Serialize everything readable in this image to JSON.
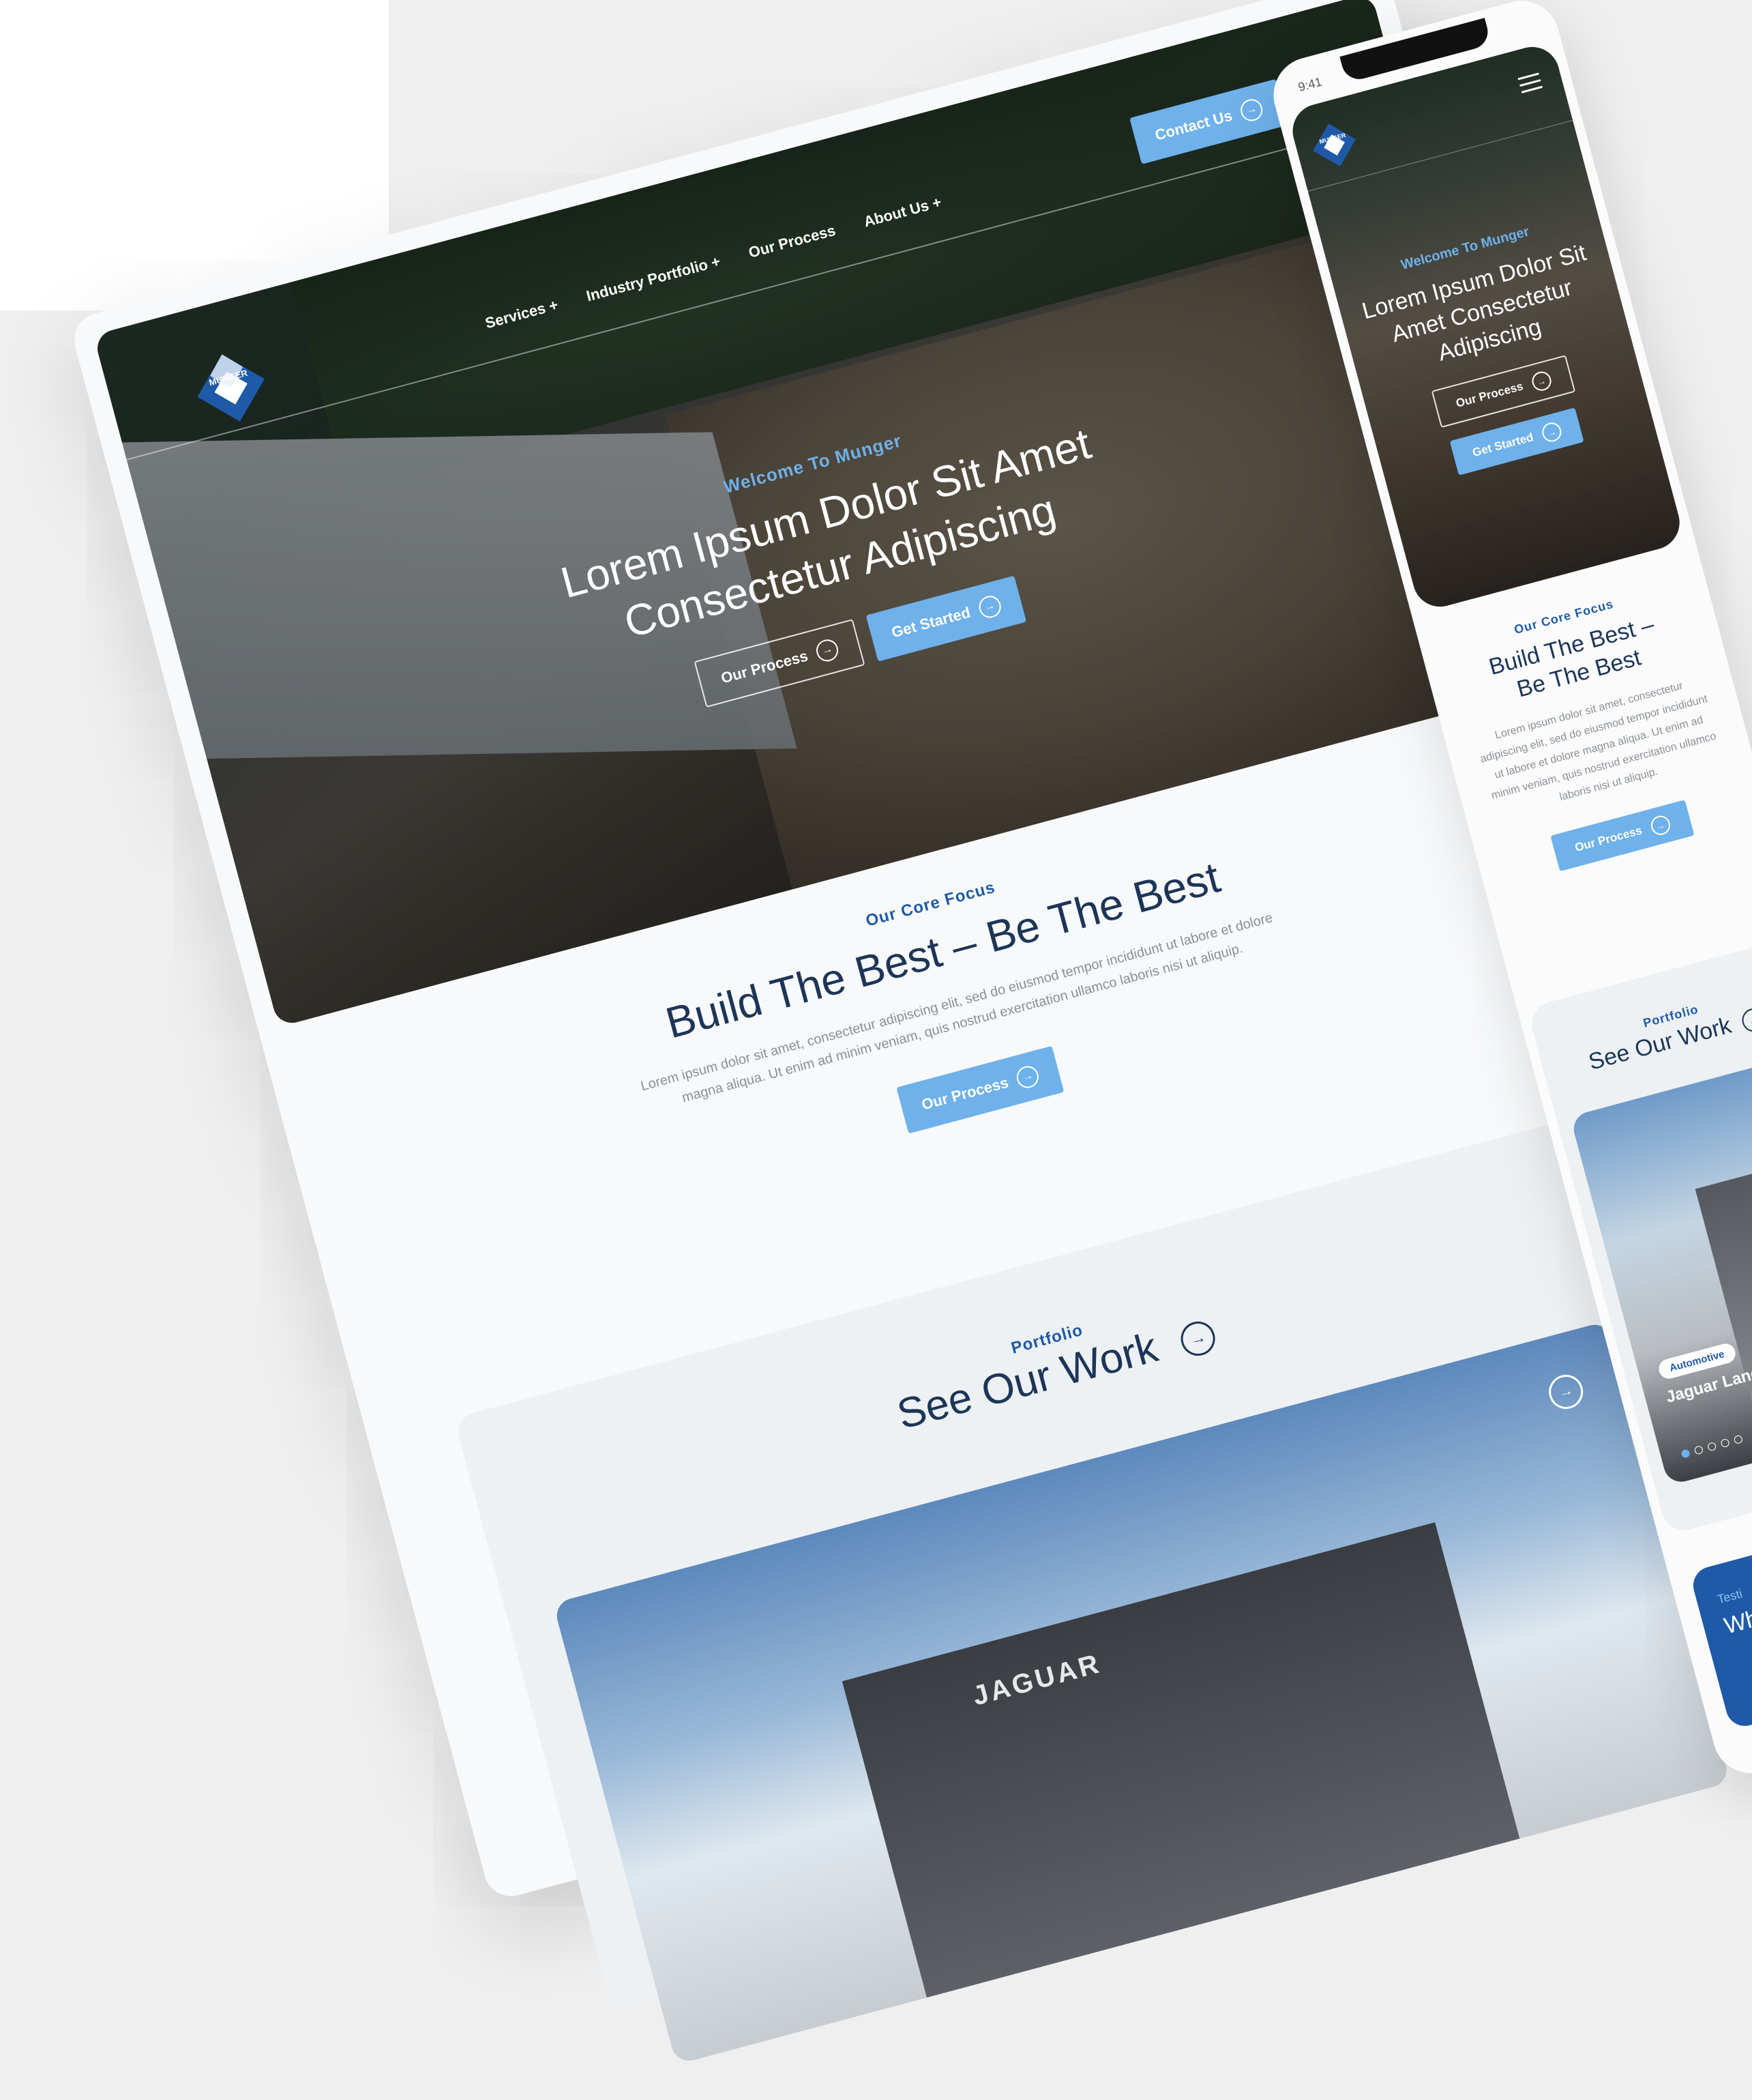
{
  "colors": {
    "accent": "#6fb1ea",
    "navy": "#1d3557",
    "brand_blue": "#1e5aa8"
  },
  "desktop": {
    "logo_text": "MUNGER",
    "nav": [
      "Services +",
      "Industry Portfolio +",
      "Our Process",
      "About Us +"
    ],
    "contact_label": "Contact Us",
    "hero": {
      "eyebrow": "Welcome To Munger",
      "title_line1": "Lorem Ipsum Dolor Sit Amet",
      "title_line2": "Consectetur Adipiscing",
      "btn_process": "Our Process",
      "btn_started": "Get Started"
    },
    "core": {
      "eyebrow": "Our Core Focus",
      "title": "Build The Best – Be The Best",
      "body": "Lorem ipsum dolor sit amet, consectetur adipiscing elit, sed do eiusmod tempor incididunt ut labore et dolore magna aliqua. Ut enim ad minim veniam, quis nostrud exercitation ullamco laboris nisi ut aliquip.",
      "btn": "Our Process"
    },
    "portfolio": {
      "eyebrow": "Portfolio",
      "title": "See Our Work",
      "image_sign": "JAGUAR"
    }
  },
  "mobile": {
    "time": "9:41",
    "logo_text": "MUNGER",
    "hero": {
      "eyebrow": "Welcome To Munger",
      "title_line1": "Lorem Ipsum Dolor Sit",
      "title_line2": "Amet Consectetur",
      "title_line3": "Adipiscing",
      "btn_process": "Our Process",
      "btn_started": "Get Started"
    },
    "core": {
      "eyebrow": "Our Core Focus",
      "title_line1": "Build The Best –",
      "title_line2": "Be The Best",
      "body": "Lorem ipsum dolor sit amet, consectetur adipiscing elit, sed do eiusmod tempor incididunt ut labore et dolore magna aliqua. Ut enim ad minim veniam, quis nostrud exercitation ullamco laboris nisi ut aliquip.",
      "btn": "Our Process"
    },
    "portfolio": {
      "eyebrow": "Portfolio",
      "title": "See Our Work",
      "card_tag": "Automotive",
      "card_title": "Jaguar Land North Haven"
    },
    "testimonial": {
      "eyebrow": "Testi",
      "title": "Wh Sa"
    }
  }
}
